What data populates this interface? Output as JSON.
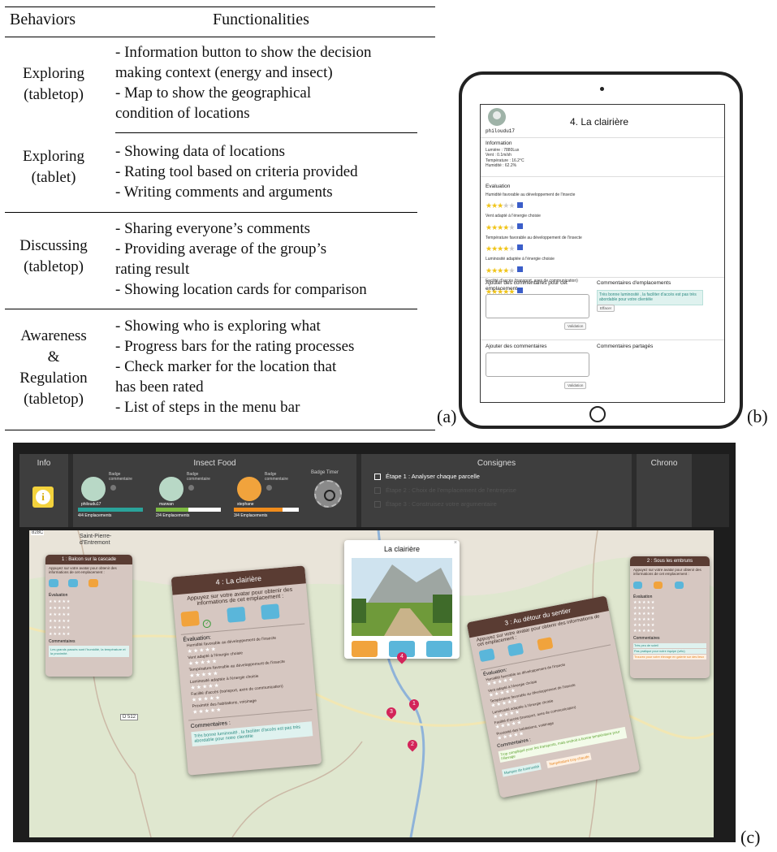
{
  "table": {
    "header_behaviors": "Behaviors",
    "header_functionalities": "Functionalities",
    "rows": [
      {
        "behavior": [
          "Exploring",
          "(tabletop)"
        ],
        "functions": [
          "- Information button to show the decision",
          "making context (energy and insect)",
          "- Map to show the geographical",
          "condition of locations"
        ]
      },
      {
        "behavior": [
          "Exploring",
          "(tablet)"
        ],
        "functions": [
          "- Showing data of locations",
          "- Rating tool based on criteria provided",
          "- Writing comments and arguments"
        ]
      },
      {
        "behavior": [
          "Discussing",
          "(tabletop)"
        ],
        "functions": [
          "- Sharing everyone’s comments",
          "- Providing average of the group’s",
          "rating result",
          "- Showing location cards for comparison"
        ]
      },
      {
        "behavior": [
          "Awareness",
          "&",
          "Regulation",
          "(tabletop)"
        ],
        "functions": [
          "- Showing who is exploring what",
          "- Progress bars for the rating processes",
          "- Check marker for the location that",
          "has been rated",
          "- List of steps in the menu bar"
        ]
      }
    ]
  },
  "captions": {
    "a": "(a)",
    "b": "(b)",
    "c": "(c)"
  },
  "tablet": {
    "username": "philoudu17",
    "title": "4. La clairière",
    "info_heading": "Information",
    "info_lines": [
      "Lumière : 7880Lux",
      "Vent : 0.1m/sh",
      "Température : 16.2°C",
      "Humidité : 62.2%"
    ],
    "eval_heading": "Evaluation",
    "criteria": [
      {
        "label": "Humidité favorable au développement de l'insecte",
        "rating": 3
      },
      {
        "label": "Vent adapté à l'énergie choisie",
        "rating": 4
      },
      {
        "label": "Température favorable au développement de l'insecte",
        "rating": 4
      },
      {
        "label": "Luminosité adaptée à l'énergie choisie",
        "rating": 4
      },
      {
        "label": "Facilité d'accès (transport, axes de communication)",
        "rating": 5
      },
      {
        "label": "Proximité des habitations, voisinage",
        "rating": 4
      }
    ],
    "add_comments_location": "Ajouter des commentaires pour cet emplacement",
    "location_comments": "Commentaires d'emplacements",
    "comment_text": "Très bonne luminosité , la faciliter d'accès est pas très abordable pour votre clientèle",
    "delete_label": "Effacer",
    "validate_label": "Validation",
    "add_comments": "Ajouter des commentaires",
    "shared_comments": "Commentaires partagés"
  },
  "tabletop": {
    "info_title": "Info",
    "team_title": "Insect Food",
    "badge_label": "Badge commentaire",
    "users": [
      {
        "name": "philoudu17",
        "progress": "4/4 Emplacements",
        "fraction": 1.0,
        "color": "#2aa39a"
      },
      {
        "name": "marwan",
        "progress": "2/4 Emplacements",
        "fraction": 0.5,
        "color": "#7dbb42"
      },
      {
        "name": "stephane",
        "progress": "3/4 Emplacements",
        "fraction": 0.75,
        "color": "#f08c1c"
      }
    ],
    "timer_badge": "Badge Timer",
    "consignes_title": "Consignes",
    "steps": [
      "Étape 1 : Analyser chaque parcelle",
      "Étape 2 : Choix de l'emplacement de l'entreprise",
      "Étape 3 : Construisez votre argumentaire"
    ],
    "chrono_title": "Chrono",
    "map_labels": {
      "town": "Saint-Pierre-d'Entremont",
      "road": "D 512",
      "tag": "828C"
    },
    "popup_title": "La clairière",
    "cards": {
      "c1": {
        "title": "1 : Balcon sur la cascade",
        "prompt": "Appuyez sur votre avatar pour obtenir des informations de cet emplacement :",
        "eval": "Évaluation",
        "comments": "Commentaires",
        "comment": "Les grands passés sont l'humidité, la température et la proximité."
      },
      "c4": {
        "title": "4 : La clairière",
        "prompt": "Appuyez sur votre avatar pour obtenir des informations de cet emplacement :",
        "eval": "Évaluation:",
        "criteria": [
          "Humidité favorable au développement de l'insecte",
          "Vent adapté à l'énergie choisie",
          "Température favorable au développement de l'insecte",
          "Luminosité adaptée à l'énergie choisie",
          "Facilité d'accès (transport, axes de communication)",
          "Proximité des habitations, voisinage"
        ],
        "comments": "Commentaires :",
        "comment": "Très bonne luminosité , la faciliter d'accès est pas très abordable pour notre clientèle"
      },
      "c3": {
        "title": "3 : Au détour du sentier",
        "prompt": "Appuyez sur votre avatar pour obtenir des informations de cet emplacement :",
        "eval": "Évaluation:",
        "criteria": [
          "Humidité favorable au développement de l'insecte",
          "Vent adapté à l'énergie choisie",
          "Température favorable au développement de l'insecte",
          "Luminosité adaptée à l'énergie choisie",
          "Facilité d'accès (transport, axes de communication)",
          "Proximité des habitations, voisinage"
        ],
        "comments": "Commentaires :",
        "comment": "Trop compliqué pour les transports, mais endroit a bonne température pour l'élevage",
        "tag1": "Manque de luminosité",
        "tag2": "Température trop chaude"
      },
      "c2": {
        "title": "2 : Sous les embruns",
        "prompt": "Appuyez sur votre avatar pour obtenir des informations de cet emplacement :",
        "eval": "Évaluation",
        "comments": "Commentaires",
        "tag1": "Très peu de soleil",
        "tag2": "Pas pratique pour notre équipe (vélo)",
        "tag3": "Trouvez pour votre élevage en galerie sur des lieux"
      }
    },
    "pins": [
      "4",
      "1",
      "3",
      "2"
    ]
  }
}
